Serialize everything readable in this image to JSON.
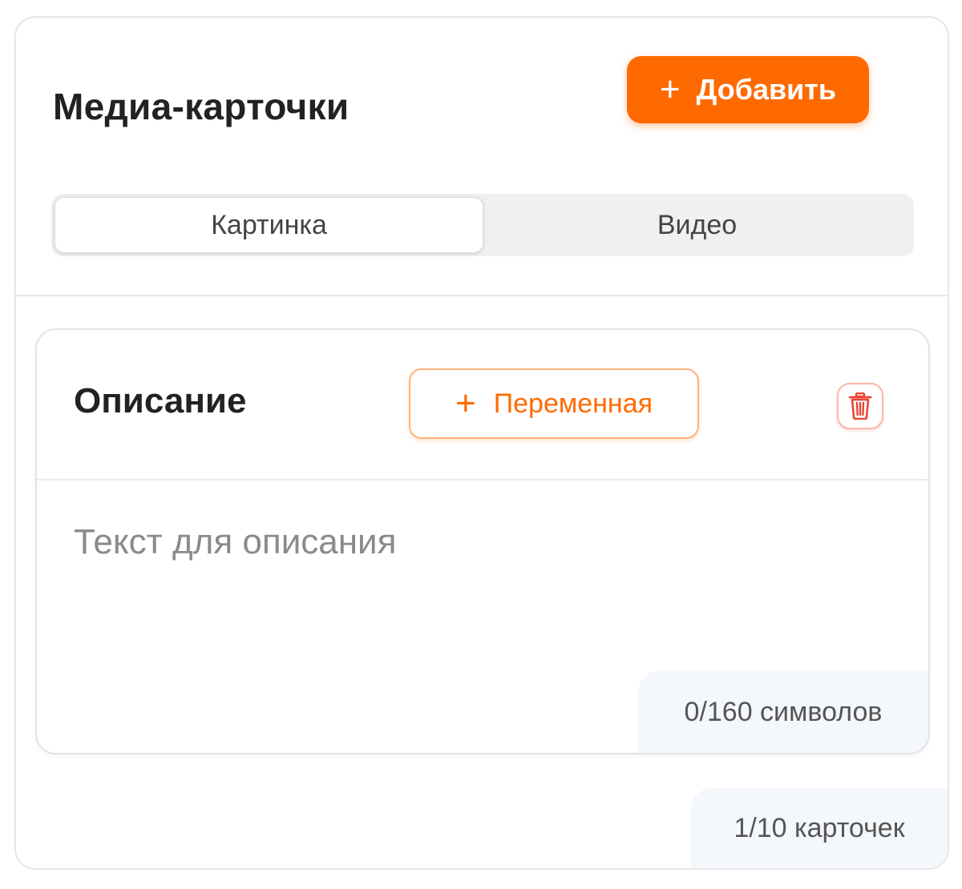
{
  "panel": {
    "title": "Медиа-карточки",
    "add_button": {
      "icon": "plus-icon",
      "label": "Добавить"
    },
    "media_type_tabs": [
      {
        "label": "Картинка",
        "selected": true
      },
      {
        "label": "Видео",
        "selected": false
      }
    ],
    "cards_counter": "1/10 карточек"
  },
  "card": {
    "title": "Описание",
    "variable_button": {
      "icon": "plus-icon",
      "label": "Переменная"
    },
    "delete_button": {
      "icon": "trash-icon"
    },
    "description_placeholder": "Текст для описания",
    "char_counter": "0/160 символов"
  },
  "colors": {
    "accent": "#ff6a00",
    "accent_border": "#ffb27a",
    "danger": "#e94536",
    "counter_bg": "#f4f7fb"
  }
}
